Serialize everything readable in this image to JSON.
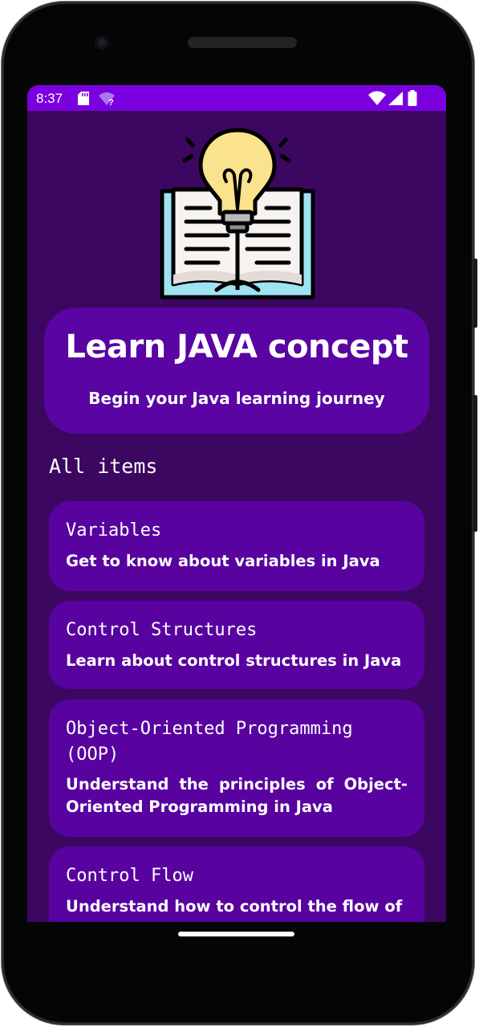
{
  "status_bar": {
    "time": "8:37",
    "icons": [
      "sd-card-icon",
      "wifi-question-icon",
      "wifi-icon",
      "cell-signal-icon",
      "battery-icon"
    ],
    "color": "#7b00e0"
  },
  "hero_icon": "book-lightbulb-icon",
  "header": {
    "title": "Learn JAVA concept",
    "subtitle": "Begin your Java learning journey"
  },
  "section": {
    "heading": "All items"
  },
  "items": [
    {
      "title": "Variables",
      "description": "Get to know about variables in Java"
    },
    {
      "title": "Control Structures",
      "description": "Learn about control structures in Java"
    },
    {
      "title": "Object-Oriented Programming (OOP)",
      "description": "Understand the principles of Object-Oriented Programming in Java"
    },
    {
      "title": "Control Flow",
      "description": "Understand how to control the flow of"
    }
  ],
  "colors": {
    "background": "#3c0761",
    "card": "#5802a0",
    "header_card": "#5a04a3",
    "status_bar": "#7b00e0",
    "text": "#ffffff"
  }
}
